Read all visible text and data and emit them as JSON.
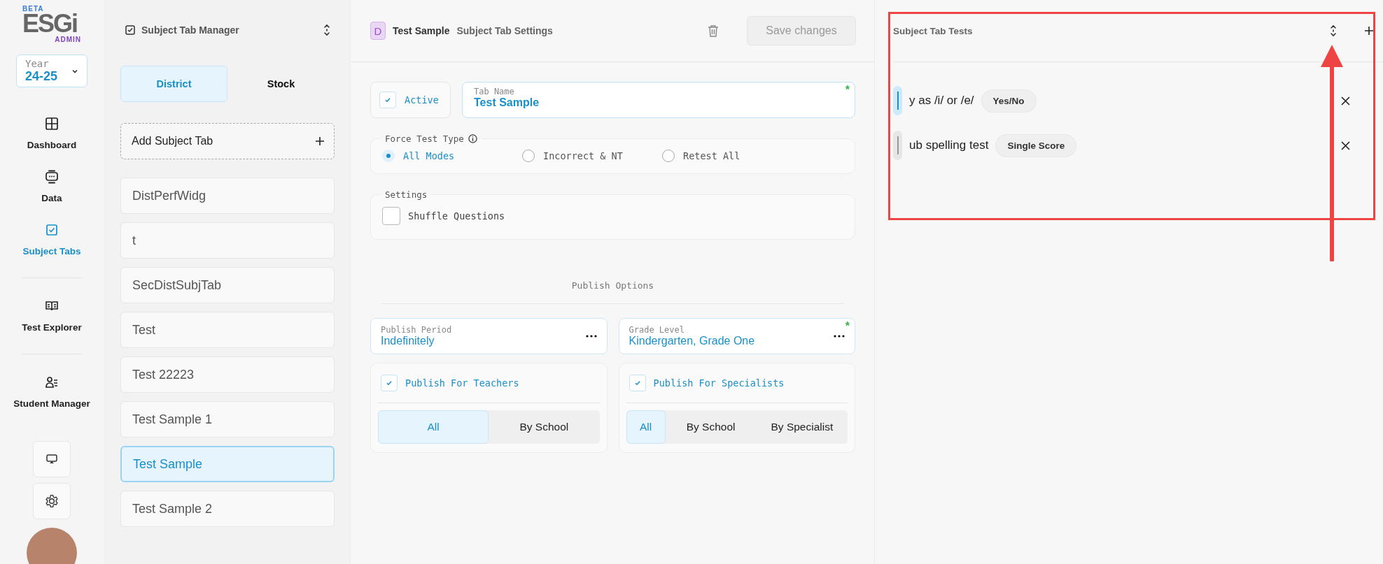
{
  "sidebar": {
    "logo": {
      "beta": "BETA",
      "name": "ESGi",
      "sub": "ADMIN"
    },
    "year": {
      "label": "Year",
      "value": "24-25"
    },
    "nav_groups": [
      [
        {
          "label": "Dashboard",
          "kind": "grid",
          "selected": false
        },
        {
          "label": "Data",
          "kind": "data",
          "selected": false
        },
        {
          "label": "Subject Tabs",
          "kind": "check",
          "selected": true
        }
      ],
      [
        {
          "label": "Test Explorer",
          "kind": "book",
          "selected": false
        }
      ],
      [
        {
          "label": "Student Manager",
          "kind": "user",
          "selected": false
        }
      ]
    ]
  },
  "tab_manager": {
    "title": "Subject Tab Manager",
    "tabs": [
      {
        "label": "District",
        "selected": true
      },
      {
        "label": "Stock",
        "selected": false
      }
    ],
    "add_label": "Add Subject Tab",
    "items": [
      {
        "label": "DistPerfWidg",
        "selected": false
      },
      {
        "label": "t",
        "selected": false
      },
      {
        "label": "SecDistSubjTab",
        "selected": false
      },
      {
        "label": "Test",
        "selected": false
      },
      {
        "label": "Test 22223",
        "selected": false
      },
      {
        "label": "Test Sample 1",
        "selected": false
      },
      {
        "label": "Test Sample",
        "selected": true
      },
      {
        "label": "Test Sample 2",
        "selected": false
      }
    ]
  },
  "settings": {
    "badge": "D",
    "title": "Test Sample",
    "subtitle": "Subject Tab Settings",
    "save_label": "Save changes",
    "save_disabled": true,
    "active": {
      "label": "Active",
      "checked": true
    },
    "tab_name": {
      "label": "Tab Name",
      "value": "Test Sample",
      "required_mark": "*"
    },
    "force_test_type": {
      "legend": "Force Test Type",
      "options": [
        {
          "label": "All Modes",
          "selected": true
        },
        {
          "label": "Incorrect & NT",
          "selected": false
        },
        {
          "label": "Retest All",
          "selected": false
        }
      ]
    },
    "settings_group": {
      "legend": "Settings",
      "options": [
        {
          "label": "Shuffle Questions",
          "checked": false
        }
      ]
    },
    "publish_heading": "Publish Options",
    "publish_fields": [
      {
        "label": "Publish Period",
        "value": "Indefinitely"
      },
      {
        "label": "Grade Level",
        "value": "Kindergarten, Grade One",
        "required_mark": "*"
      }
    ],
    "publish_groups": [
      {
        "label": "Publish For Teachers",
        "checked": true,
        "options": [
          {
            "label": "All",
            "selected": true
          },
          {
            "label": "By School",
            "selected": false
          }
        ]
      },
      {
        "label": "Publish For Specialists",
        "checked": true,
        "options": [
          {
            "label": "All",
            "selected": true
          },
          {
            "label": "By School",
            "selected": false
          },
          {
            "label": "By Specialist",
            "selected": false
          }
        ]
      }
    ]
  },
  "tests_panel": {
    "title": "Subject Tab Tests",
    "tests": [
      {
        "name": "y as /i/ or /e/",
        "type": "Yes/No",
        "selected": true
      },
      {
        "name": "ub spelling test",
        "type": "Single Score",
        "selected": false
      }
    ]
  }
}
